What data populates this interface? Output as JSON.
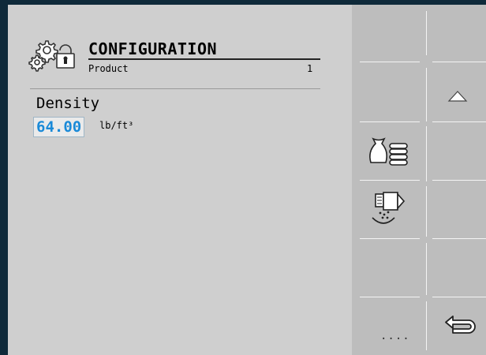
{
  "header": {
    "icon": "gear-lock-icon",
    "title": "CONFIGURATION",
    "subtitle": "Product",
    "subtitle_number": "1"
  },
  "field": {
    "label": "Density",
    "value": "64.00",
    "unit": "lb/ft³"
  },
  "softkeys": {
    "more_label": "...."
  },
  "colors": {
    "value_text": "#1a8ad8",
    "background": "#cfcfcf",
    "softkey_panel": "#bdbdbd"
  }
}
